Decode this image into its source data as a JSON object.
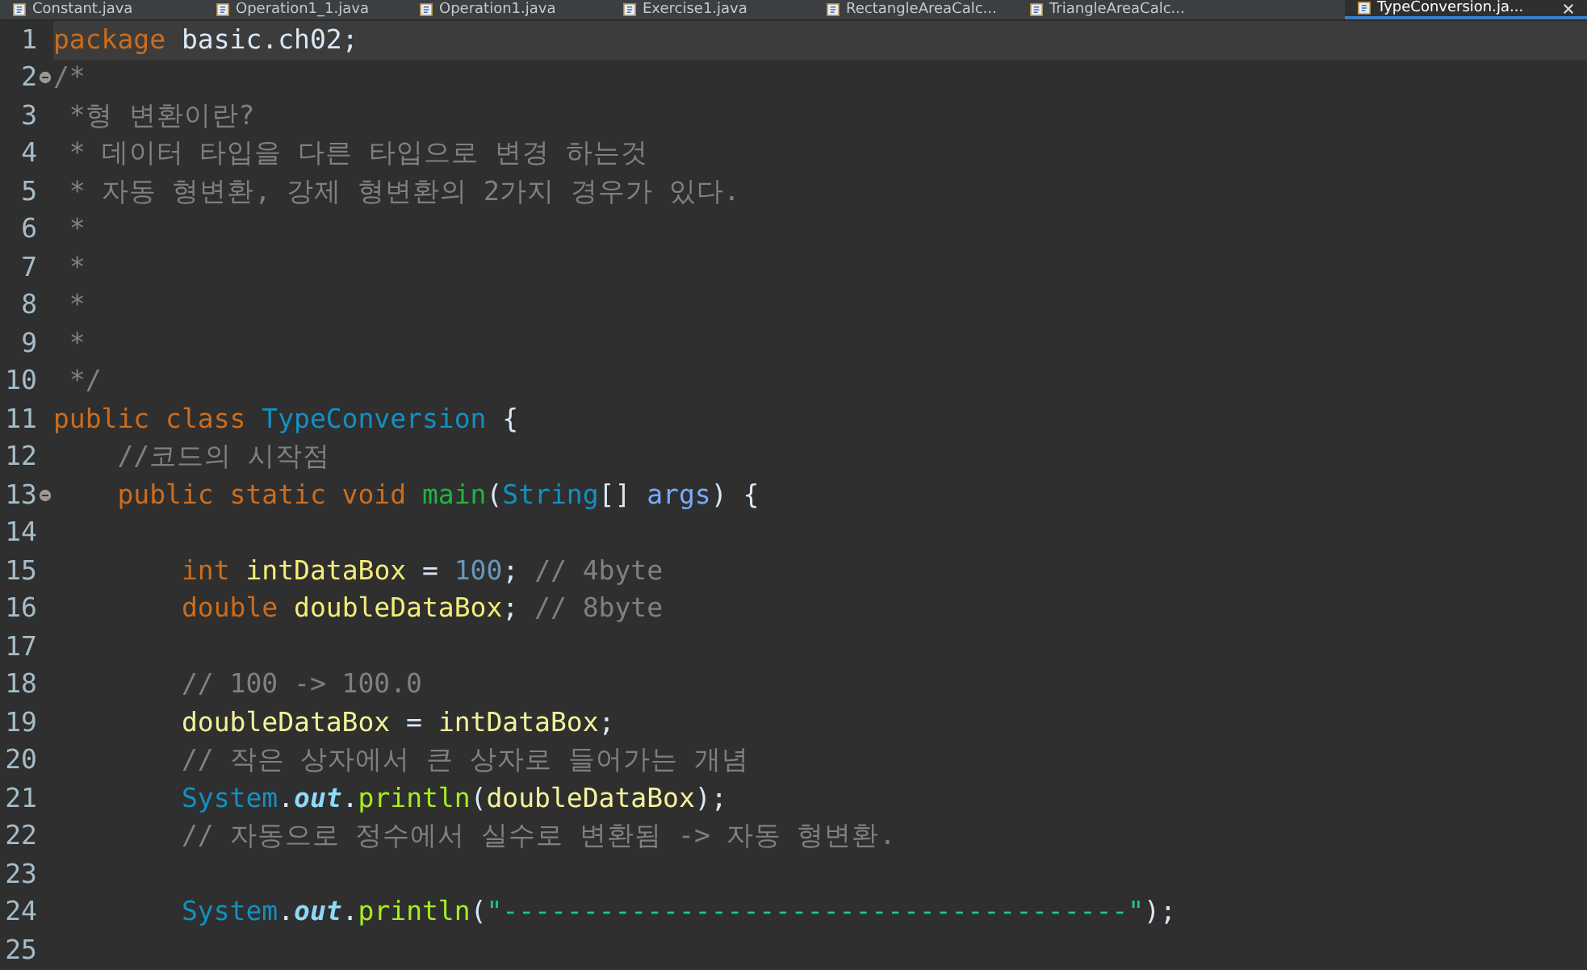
{
  "tabs": [
    {
      "label": "Constant.java",
      "selected": false
    },
    {
      "label": "Operation1_1.java",
      "selected": false
    },
    {
      "label": "Operation1.java",
      "selected": false
    },
    {
      "label": "Exercise1.java",
      "selected": false
    },
    {
      "label": "RectangleAreaCalc...",
      "selected": false
    },
    {
      "label": "TriangleAreaCalc...",
      "selected": false
    },
    {
      "label": "TypeConversion.ja...",
      "selected": true
    }
  ],
  "lines": [
    {
      "number": "1",
      "fold": false,
      "current": true,
      "tokens": [
        {
          "kind": "keyword",
          "text": "package"
        },
        {
          "kind": "plain",
          "text": " basic.ch02;"
        }
      ]
    },
    {
      "number": "2",
      "fold": true,
      "current": false,
      "tokens": [
        {
          "kind": "comment",
          "text": "/*"
        }
      ]
    },
    {
      "number": "3",
      "fold": false,
      "current": false,
      "tokens": [
        {
          "kind": "comment",
          "text": " *형 변환이란?"
        }
      ]
    },
    {
      "number": "4",
      "fold": false,
      "current": false,
      "tokens": [
        {
          "kind": "comment",
          "text": " * 데이터 타입을 다른 타입으로 변경 하는것"
        }
      ]
    },
    {
      "number": "5",
      "fold": false,
      "current": false,
      "tokens": [
        {
          "kind": "comment",
          "text": " * 자동 형변환, 강제 형변환의 2가지 경우가 있다."
        }
      ]
    },
    {
      "number": "6",
      "fold": false,
      "current": false,
      "tokens": [
        {
          "kind": "comment",
          "text": " *"
        }
      ]
    },
    {
      "number": "7",
      "fold": false,
      "current": false,
      "tokens": [
        {
          "kind": "comment",
          "text": " *"
        }
      ]
    },
    {
      "number": "8",
      "fold": false,
      "current": false,
      "tokens": [
        {
          "kind": "comment",
          "text": " *"
        }
      ]
    },
    {
      "number": "9",
      "fold": false,
      "current": false,
      "tokens": [
        {
          "kind": "comment",
          "text": " *"
        }
      ]
    },
    {
      "number": "10",
      "fold": false,
      "current": false,
      "tokens": [
        {
          "kind": "comment",
          "text": " */"
        }
      ]
    },
    {
      "number": "11",
      "fold": false,
      "current": false,
      "tokens": [
        {
          "kind": "keyword",
          "text": "public class "
        },
        {
          "kind": "class",
          "text": "TypeConversion"
        },
        {
          "kind": "plain",
          "text": " {"
        }
      ]
    },
    {
      "number": "12",
      "fold": false,
      "current": false,
      "tokens": [
        {
          "kind": "comment",
          "text": "    //코드의 시작점"
        }
      ]
    },
    {
      "number": "13",
      "fold": true,
      "current": false,
      "tokens": [
        {
          "kind": "keyword",
          "text": "    public static void "
        },
        {
          "kind": "method",
          "text": "main"
        },
        {
          "kind": "plain",
          "text": "("
        },
        {
          "kind": "class",
          "text": "String"
        },
        {
          "kind": "plain",
          "text": "[] "
        },
        {
          "kind": "param",
          "text": "args"
        },
        {
          "kind": "plain",
          "text": ") {"
        }
      ]
    },
    {
      "number": "14",
      "fold": false,
      "current": false
    },
    {
      "number": "15",
      "fold": false,
      "current": false,
      "tokens": [
        {
          "kind": "keyword",
          "text": "        int "
        },
        {
          "kind": "variable",
          "text": "intDataBox"
        },
        {
          "kind": "plain",
          "text": " = "
        },
        {
          "kind": "number",
          "text": "100"
        },
        {
          "kind": "plain",
          "text": "; "
        },
        {
          "kind": "comment",
          "text": "// 4byte"
        }
      ]
    },
    {
      "number": "16",
      "fold": false,
      "current": false,
      "tokens": [
        {
          "kind": "keyword",
          "text": "        double "
        },
        {
          "kind": "variable",
          "text": "doubleDataBox"
        },
        {
          "kind": "plain",
          "text": "; "
        },
        {
          "kind": "comment",
          "text": "// 8byte"
        }
      ]
    },
    {
      "number": "17",
      "fold": false,
      "current": false
    },
    {
      "number": "18",
      "fold": false,
      "current": false,
      "tokens": [
        {
          "kind": "comment",
          "text": "        // 100 -> 100.0"
        }
      ]
    },
    {
      "number": "19",
      "fold": false,
      "current": false,
      "tokens": [
        {
          "kind": "local",
          "text": "        doubleDataBox"
        },
        {
          "kind": "plain",
          "text": " = "
        },
        {
          "kind": "local",
          "text": "intDataBox"
        },
        {
          "kind": "plain",
          "text": ";"
        }
      ]
    },
    {
      "number": "20",
      "fold": false,
      "current": false,
      "tokens": [
        {
          "kind": "comment",
          "text": "        // 작은 상자에서 큰 상자로 들어가는 개념"
        }
      ]
    },
    {
      "number": "21",
      "fold": false,
      "current": false,
      "tokens": [
        {
          "kind": "class",
          "text": "        System"
        },
        {
          "kind": "plain",
          "text": "."
        },
        {
          "kind": "field",
          "text": "out"
        },
        {
          "kind": "plain",
          "text": "."
        },
        {
          "kind": "call",
          "text": "println"
        },
        {
          "kind": "plain",
          "text": "("
        },
        {
          "kind": "local",
          "text": "doubleDataBox"
        },
        {
          "kind": "plain",
          "text": ");"
        }
      ]
    },
    {
      "number": "22",
      "fold": false,
      "current": false,
      "tokens": [
        {
          "kind": "comment",
          "text": "        // 자동으로 정수에서 실수로 변환됨 -> 자동 형변환."
        }
      ]
    },
    {
      "number": "23",
      "fold": false,
      "current": false
    },
    {
      "number": "24",
      "fold": false,
      "current": false,
      "tokens": [
        {
          "kind": "class",
          "text": "        System"
        },
        {
          "kind": "plain",
          "text": "."
        },
        {
          "kind": "field",
          "text": "out"
        },
        {
          "kind": "plain",
          "text": "."
        },
        {
          "kind": "call",
          "text": "println"
        },
        {
          "kind": "plain",
          "text": "("
        },
        {
          "kind": "string",
          "text": "\"---------------------------------------\""
        },
        {
          "kind": "plain",
          "text": ");"
        }
      ]
    },
    {
      "number": "25",
      "fold": false,
      "current": false
    }
  ]
}
